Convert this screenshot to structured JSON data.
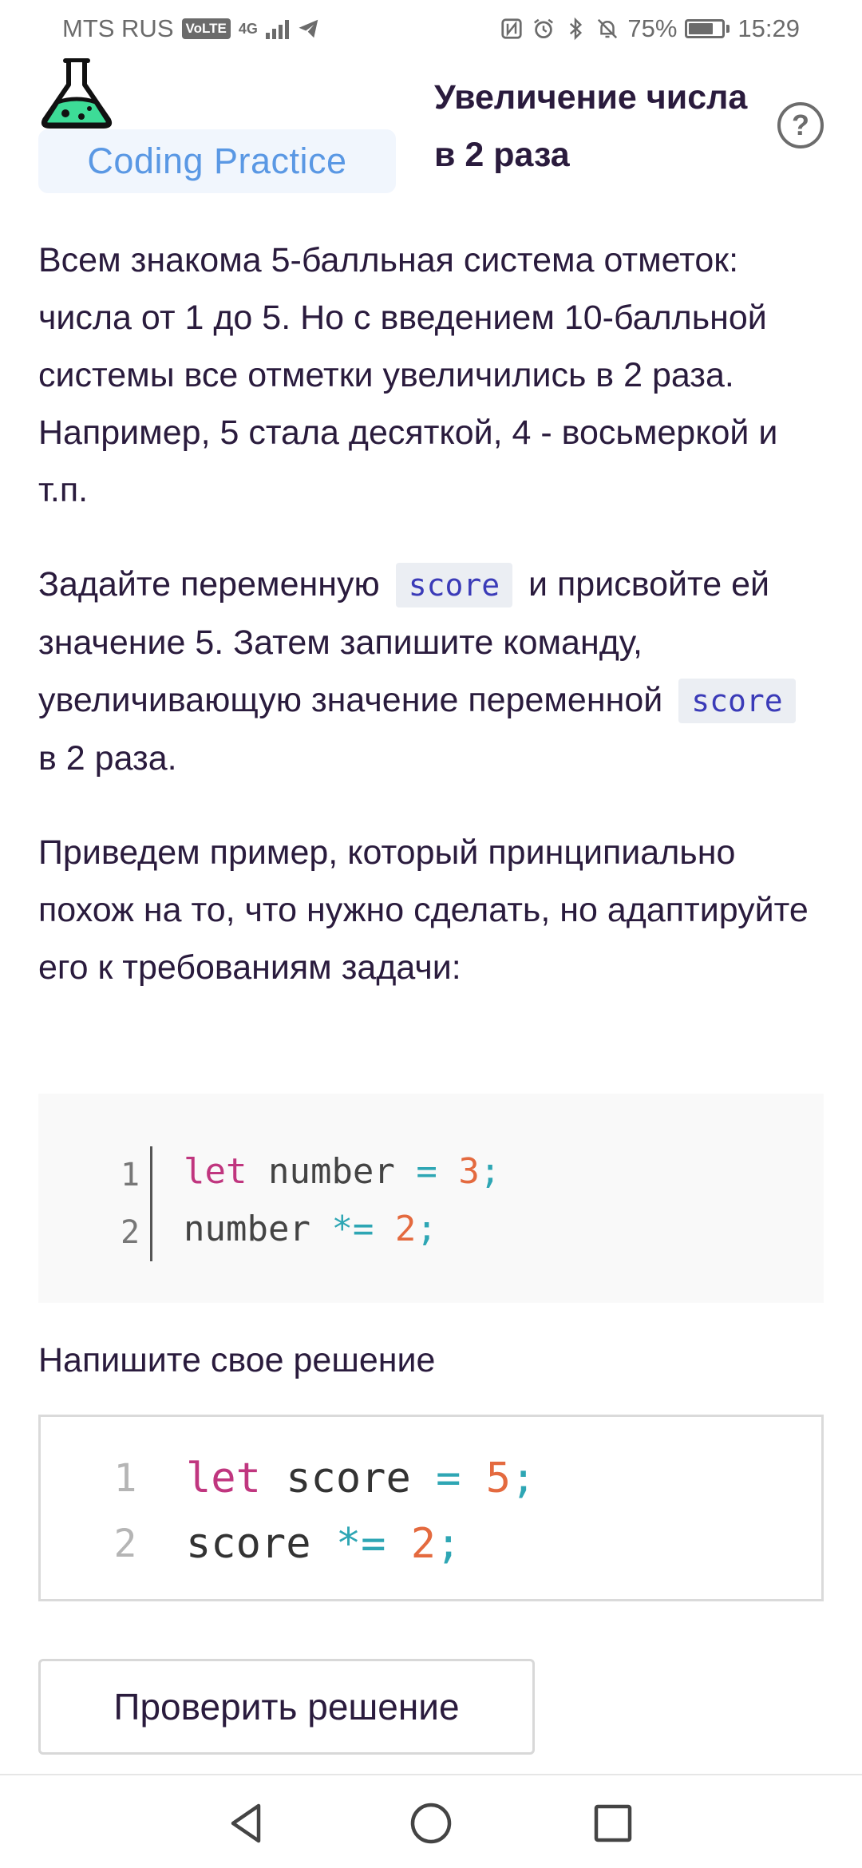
{
  "status_bar": {
    "carrier": "MTS RUS",
    "volte": "VoLTE",
    "network": "4G",
    "battery": "75%",
    "time": "15:29",
    "battery_level": 0.75
  },
  "header": {
    "tag": "Coding Practice",
    "title": "Увеличение числа в 2 раза",
    "help_symbol": "?"
  },
  "content": {
    "paragraph1": "Всем знакома 5-балльная система отметок: числа от 1 до 5. Но с введением 10-балльной системы все отметки увеличились в 2 раза. Например, 5 стала десяткой, 4 - восьмеркой и т.п.",
    "paragraph2": {
      "part1": "Задайте переменную",
      "code1": "score",
      "part2": "и присвойте ей значение 5. Затем запишите команду, увеличивающую значение переменной",
      "code2": "score",
      "part3": "в 2 раза."
    },
    "paragraph3": "Приведем пример, который принципиально похож на то, что нужно сделать, но адаптируйте его к требованиям задачи:"
  },
  "example": {
    "line_numbers": [
      "1",
      "2"
    ],
    "line1": {
      "kw": "let",
      "var": " number ",
      "op": "=",
      "num": " 3",
      "punc": ";"
    },
    "line2": {
      "var": "number ",
      "op": "*=",
      "num": " 2",
      "punc": ";"
    }
  },
  "solution": {
    "label": "Напишите свое решение",
    "line_numbers": [
      "1",
      "2"
    ],
    "line1": {
      "kw": "let",
      "var": " score ",
      "op": "=",
      "num": " 5",
      "punc": ";"
    },
    "line2": {
      "var": "score ",
      "op": "*=",
      "num": " 2",
      "punc": ";"
    }
  },
  "actions": {
    "check_label": "Проверить решение"
  }
}
